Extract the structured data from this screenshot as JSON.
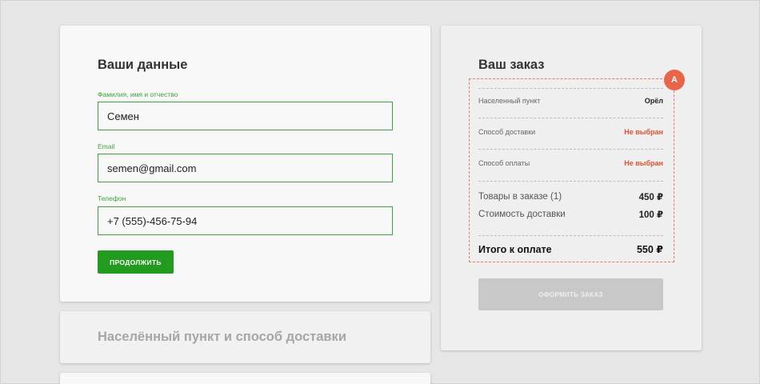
{
  "personal": {
    "title": "Ваши данные",
    "name_label": "Фамилия, имя и отчество",
    "name_value": "Семен",
    "email_label": "Email",
    "email_value": "semen@gmail.com",
    "phone_label": "Телефон",
    "phone_value": "+7 (555)-456-75-94",
    "continue_label": "ПРОДОЛЖИТЬ"
  },
  "delivery": {
    "title": "Населённый пункт и способ доставки"
  },
  "order": {
    "title": "Ваш заказ",
    "marker": "A",
    "city_label": "Населенный пункт",
    "city_value": "Орёл",
    "delivery_label": "Способ доставки",
    "delivery_value": "Не выбран",
    "payment_label": "Способ оплаты",
    "payment_value": "Не выбран",
    "items_label": "Товары в заказе (1)",
    "items_value": "450 ₽",
    "shipping_label": "Стоимость доставки",
    "shipping_value": "100 ₽",
    "total_label": "Итого к оплате",
    "total_value": "550 ₽",
    "submit_label": "ОФОРМИТЬ ЗАКАЗ"
  },
  "colors": {
    "accent_green": "#239b1f",
    "warning": "#e0532f",
    "marker": "#e9644a"
  }
}
